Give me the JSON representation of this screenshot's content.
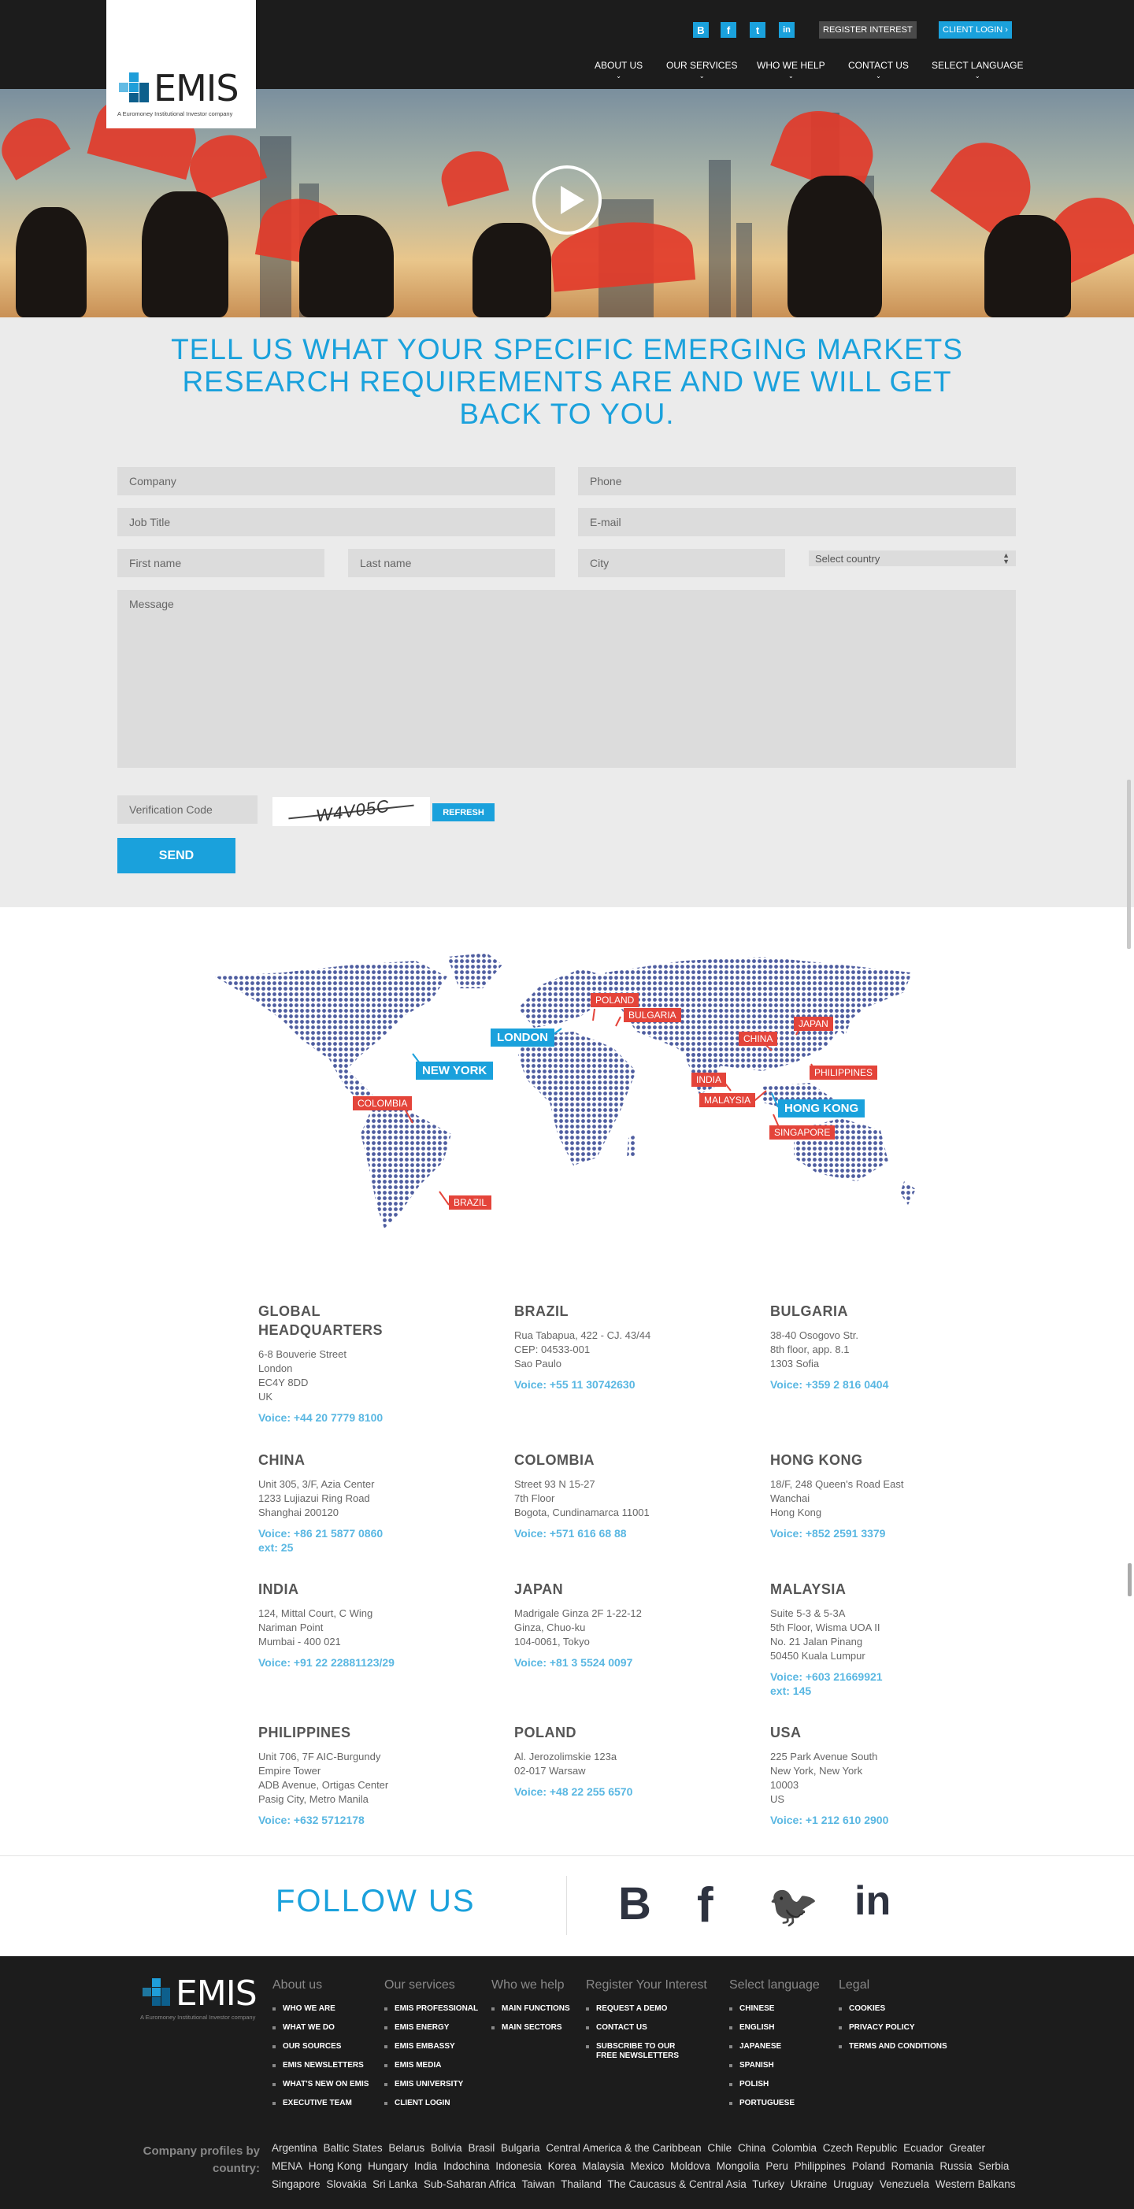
{
  "brand": {
    "name": "EMIS",
    "tagline": "A Euromoney Institutional Investor company"
  },
  "header": {
    "social": [
      {
        "icon": "blogger-icon",
        "glyph": "B"
      },
      {
        "icon": "facebook-icon",
        "glyph": "f"
      },
      {
        "icon": "twitter-icon",
        "glyph": "t"
      },
      {
        "icon": "linkedin-icon",
        "glyph": "in"
      }
    ],
    "register_label": "REGISTER INTEREST",
    "client_login_label": "CLIENT LOGIN ›",
    "nav": [
      "ABOUT US",
      "OUR SERVICES",
      "WHO WE HELP",
      "CONTACT US",
      "SELECT LANGUAGE"
    ]
  },
  "form": {
    "heading": "TELL US WHAT YOUR SPECIFIC EMERGING MARKETS RESEARCH REQUIREMENTS ARE AND WE WILL GET BACK TO YOU.",
    "company": "Company",
    "phone": "Phone",
    "job_title": "Job Title",
    "email": "E-mail",
    "first_name": "First name",
    "last_name": "Last name",
    "city": "City",
    "country": "Select country",
    "message": "Message",
    "verification": "Verification Code",
    "captcha_text": "W4V05C",
    "refresh_label": "REFRESH",
    "send_label": "SEND"
  },
  "map": {
    "red": [
      "POLAND",
      "BULGARIA",
      "JAPAN",
      "CHINA",
      "PHILIPPINES",
      "INDIA",
      "MALAYSIA",
      "SINGAPORE",
      "COLOMBIA",
      "BRAZIL"
    ],
    "blue": [
      "LONDON",
      "NEW YORK",
      "HONG KONG"
    ]
  },
  "offices": [
    {
      "name": "GLOBAL\nHEADQUARTERS",
      "address": "6-8 Bouverie Street\nLondon\nEC4Y 8DD\nUK",
      "voice": "Voice: +44 20 7779 8100"
    },
    {
      "name": "BRAZIL",
      "address": "Rua Tabapua, 422 - CJ. 43/44\nCEP: 04533-001\nSao Paulo",
      "voice": "Voice: +55 11 30742630"
    },
    {
      "name": "BULGARIA",
      "address": "38-40 Osogovo Str.\n8th floor, app. 8.1\n1303 Sofia",
      "voice": "Voice: +359 2 816 0404"
    },
    {
      "name": "CHINA",
      "address": "Unit 305, 3/F, Azia Center\n1233 Lujiazui Ring Road\nShanghai 200120",
      "voice": "Voice: +86 21 5877 0860\next: 25"
    },
    {
      "name": "COLOMBIA",
      "address": "Street 93 N 15-27\n7th Floor\nBogota, Cundinamarca 11001",
      "voice": "Voice: +571 616 68 88"
    },
    {
      "name": "HONG KONG",
      "address": "18/F, 248 Queen's Road East\nWanchai\nHong Kong",
      "voice": "Voice: +852 2591 3379"
    },
    {
      "name": "INDIA",
      "address": "124, Mittal Court, C Wing\nNariman Point\nMumbai - 400 021",
      "voice": "Voice: +91 22 22881123/29"
    },
    {
      "name": "JAPAN",
      "address": "Madrigale Ginza 2F 1-22-12\nGinza, Chuo-ku\n104-0061, Tokyo",
      "voice": "Voice: +81 3 5524 0097"
    },
    {
      "name": "MALAYSIA",
      "address": "Suite 5-3 & 5-3A\n5th Floor, Wisma UOA II\nNo. 21 Jalan Pinang\n50450 Kuala Lumpur",
      "voice": "Voice: +603 21669921\next: 145"
    },
    {
      "name": "PHILIPPINES",
      "address": "Unit 706, 7F AIC-Burgundy\nEmpire Tower\nADB Avenue, Ortigas Center\nPasig City, Metro Manila",
      "voice": "Voice: +632 5712178"
    },
    {
      "name": "POLAND",
      "address": "Al. Jerozolimskie 123a\n02-017 Warsaw",
      "voice": "Voice: +48 22 255 6570"
    },
    {
      "name": "USA",
      "address": "225 Park Avenue South\nNew York, New York\n10003\nUS",
      "voice": "Voice: +1 212 610 2900"
    }
  ],
  "follow": {
    "title": "FOLLOW US",
    "icons": [
      {
        "icon": "blogger-icon",
        "glyph": "B"
      },
      {
        "icon": "facebook-icon",
        "glyph": "f"
      },
      {
        "icon": "twitter-icon",
        "glyph": "🐦"
      },
      {
        "icon": "linkedin-icon",
        "glyph": "in"
      }
    ]
  },
  "footer": {
    "columns": [
      {
        "title": "About us",
        "items": [
          "WHO WE ARE",
          "WHAT WE DO",
          "OUR SOURCES",
          "EMIS NEWSLETTERS",
          "WHAT'S NEW ON EMIS",
          "EXECUTIVE TEAM"
        ]
      },
      {
        "title": "Our services",
        "items": [
          "EMIS PROFESSIONAL",
          "EMIS ENERGY",
          "EMIS EMBASSY",
          "EMIS MEDIA",
          "EMIS UNIVERSITY",
          "CLIENT LOGIN"
        ]
      },
      {
        "title": "Who we help",
        "items": [
          "MAIN FUNCTIONS",
          "MAIN SECTORS"
        ]
      },
      {
        "title": "Register Your Interest",
        "items": [
          "REQUEST A DEMO",
          "CONTACT US",
          "SUBSCRIBE TO OUR\nFREE NEWSLETTERS"
        ]
      },
      {
        "title": "Select language",
        "items": [
          "CHINESE",
          "ENGLISH",
          "JAPANESE",
          "SPANISH",
          "POLISH",
          "PORTUGUESE"
        ]
      },
      {
        "title": "Legal",
        "items": [
          "COOKIES",
          "PRIVACY POLICY",
          "TERMS AND CONDITIONS"
        ]
      }
    ],
    "profiles_label": "Company profiles by country:",
    "countries": [
      "Argentina",
      "Baltic States",
      "Belarus",
      "Bolivia",
      "Brasil",
      "Bulgaria",
      "Central America & the Caribbean",
      "Chile",
      "China",
      "Colombia",
      "Czech Republic",
      "Ecuador",
      "Greater MENA",
      "Hong Kong",
      "Hungary",
      "India",
      "Indochina",
      "Indonesia",
      "Korea",
      "Malaysia",
      "Mexico",
      "Moldova",
      "Mongolia",
      "Peru",
      "Philippines",
      "Poland",
      "Romania",
      "Russia",
      "Serbia",
      "Singapore",
      "Slovakia",
      "Sri Lanka",
      "Sub-Saharan Africa",
      "Taiwan",
      "Thailand",
      "The Caucasus & Central Asia",
      "Turkey",
      "Ukraine",
      "Uruguay",
      "Venezuela",
      "Western Balkans"
    ]
  }
}
